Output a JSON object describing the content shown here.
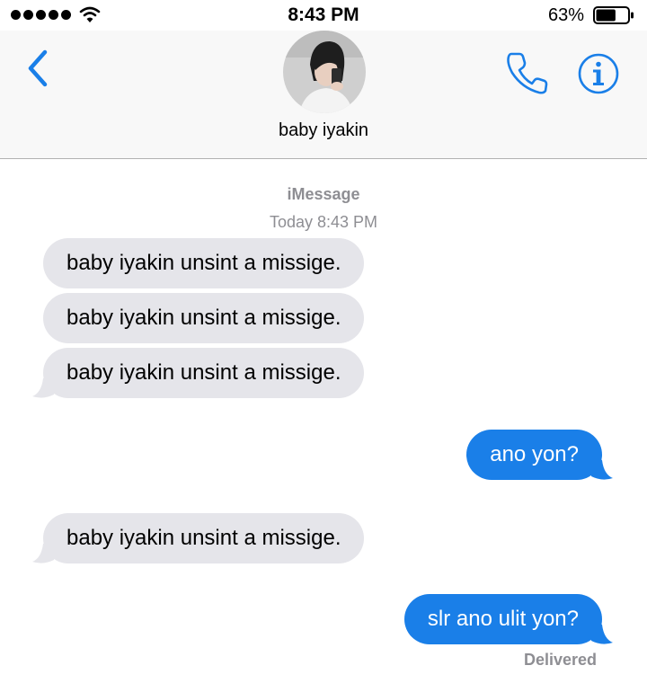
{
  "status_bar": {
    "time": "8:43 PM",
    "battery_percent": "63%",
    "battery_level": 0.63
  },
  "header": {
    "contact_name": "baby iyakin"
  },
  "thread": {
    "service": "iMessage",
    "timestamp": "Today 8:43 PM",
    "messages": [
      {
        "sender": "them",
        "text": "baby iyakin unsint a missige."
      },
      {
        "sender": "them",
        "text": "baby iyakin unsint a missige."
      },
      {
        "sender": "them",
        "text": "baby iyakin unsint a missige."
      },
      {
        "sender": "me",
        "text": "ano yon?"
      },
      {
        "sender": "them",
        "text": "baby iyakin unsint a missige."
      },
      {
        "sender": "me",
        "text": "slr ano ulit yon?"
      }
    ],
    "delivered_label": "Delivered"
  },
  "colors": {
    "accent": "#1a7fe8",
    "received_bubble": "#e5e5ea",
    "meta_gray": "#8e8e93"
  },
  "icons": [
    "signal-icon",
    "wifi-icon",
    "battery-icon",
    "back-chevron-icon",
    "phone-icon",
    "info-icon"
  ]
}
